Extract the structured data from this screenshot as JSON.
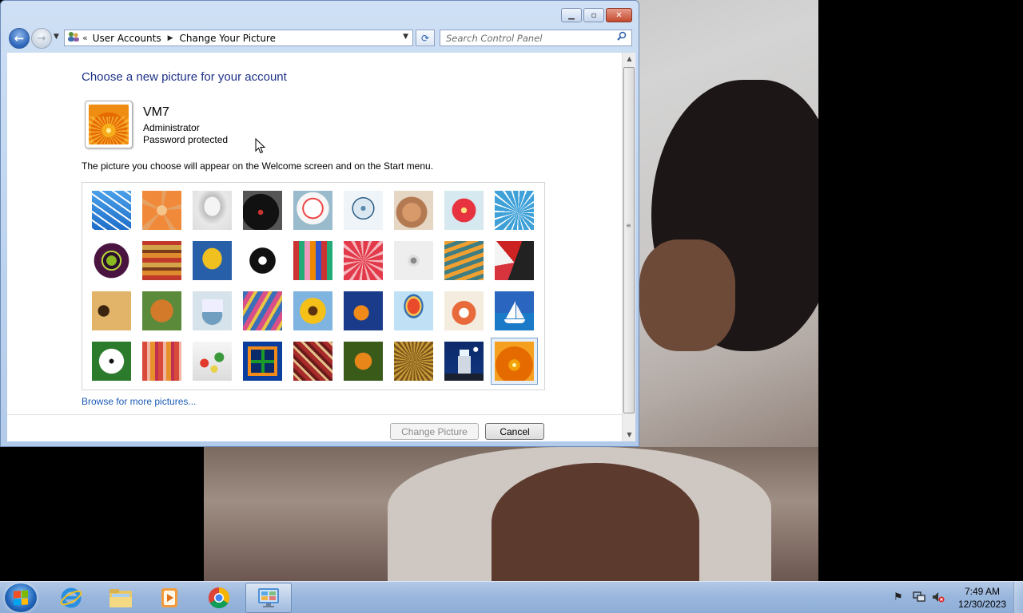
{
  "window": {
    "breadcrumb": {
      "parent": "User Accounts",
      "current": "Change Your Picture"
    },
    "search": {
      "placeholder": "Search Control Panel"
    },
    "caption_buttons": {
      "minimize": "▁",
      "restore": "▫",
      "close": "✕"
    }
  },
  "page": {
    "title": "Choose a new picture for your account",
    "account": {
      "name": "VM7",
      "role": "Administrator",
      "status": "Password protected"
    },
    "description": "The picture you choose will appear on the Welcome screen and on the Start menu.",
    "browse_link": "Browse for more pictures...",
    "pictures": [
      {
        "name": "roller-coaster-picture",
        "selected": false,
        "icon": "roller-coaster"
      },
      {
        "name": "starfish-picture",
        "selected": false,
        "icon": "starfish"
      },
      {
        "name": "robot-toy-picture",
        "selected": false,
        "icon": "robot"
      },
      {
        "name": "record-player-picture",
        "selected": false,
        "icon": "record-player"
      },
      {
        "name": "lucky-cat-picture",
        "selected": false,
        "icon": "lucky-cat"
      },
      {
        "name": "gyroscope-picture",
        "selected": false,
        "icon": "gyroscope"
      },
      {
        "name": "kitten-picture",
        "selected": false,
        "icon": "kitten"
      },
      {
        "name": "pink-flower-picture",
        "selected": false,
        "icon": "flower"
      },
      {
        "name": "ferris-wheel-picture",
        "selected": false,
        "icon": "ferris-wheel"
      },
      {
        "name": "ball-picture",
        "selected": false,
        "icon": "ball"
      },
      {
        "name": "fabric-stack-picture",
        "selected": false,
        "icon": "fabric"
      },
      {
        "name": "ginkgo-leaf-picture",
        "selected": false,
        "icon": "leaf"
      },
      {
        "name": "dog-picture",
        "selected": false,
        "icon": "dog"
      },
      {
        "name": "crayons-picture",
        "selected": false,
        "icon": "crayons"
      },
      {
        "name": "paper-star-picture",
        "selected": false,
        "icon": "star"
      },
      {
        "name": "jacks-picture",
        "selected": false,
        "icon": "jacks"
      },
      {
        "name": "stairs-picture",
        "selected": false,
        "icon": "stairs"
      },
      {
        "name": "origami-crane-picture",
        "selected": false,
        "icon": "crane"
      },
      {
        "name": "guitar-picture",
        "selected": false,
        "icon": "guitar"
      },
      {
        "name": "puppy-picture",
        "selected": false,
        "icon": "puppy"
      },
      {
        "name": "tin-robot-picture",
        "selected": false,
        "icon": "tin-robot"
      },
      {
        "name": "scarf-picture",
        "selected": false,
        "icon": "scarf"
      },
      {
        "name": "sunflower-picture",
        "selected": false,
        "icon": "sunflower"
      },
      {
        "name": "fish-picture",
        "selected": false,
        "icon": "fish"
      },
      {
        "name": "hot-air-balloon-picture",
        "selected": false,
        "icon": "balloon"
      },
      {
        "name": "daruma-doll-picture",
        "selected": false,
        "icon": "doll"
      },
      {
        "name": "sailboat-picture",
        "selected": false,
        "icon": "sailboat"
      },
      {
        "name": "soccer-ball-picture",
        "selected": false,
        "icon": "soccer-ball"
      },
      {
        "name": "striped-fabric-picture",
        "selected": false,
        "icon": "striped-fabric"
      },
      {
        "name": "marbles-picture",
        "selected": false,
        "icon": "marbles"
      },
      {
        "name": "window-picture",
        "selected": false,
        "icon": "window"
      },
      {
        "name": "carpet-picture",
        "selected": false,
        "icon": "carpet"
      },
      {
        "name": "butterfly-picture",
        "selected": false,
        "icon": "butterfly"
      },
      {
        "name": "basket-picture",
        "selected": false,
        "icon": "basket"
      },
      {
        "name": "lighthouse-picture",
        "selected": false,
        "icon": "lighthouse"
      },
      {
        "name": "orange-flower-picture",
        "selected": true,
        "icon": "orange-flower"
      }
    ],
    "buttons": {
      "change_picture": "Change Picture",
      "cancel": "Cancel"
    }
  },
  "taskbar": {
    "apps": [
      {
        "name": "internet-explorer",
        "active": false
      },
      {
        "name": "windows-explorer",
        "active": false
      },
      {
        "name": "media-player",
        "active": false
      },
      {
        "name": "chrome",
        "active": false
      },
      {
        "name": "control-panel",
        "active": true
      }
    ],
    "clock": {
      "time": "7:49 AM",
      "date": "12/30/2023"
    }
  },
  "colors": {
    "title_blue": "#1e3287",
    "link_blue": "#1b5bb6",
    "taskbar": "#9ab7dd"
  }
}
